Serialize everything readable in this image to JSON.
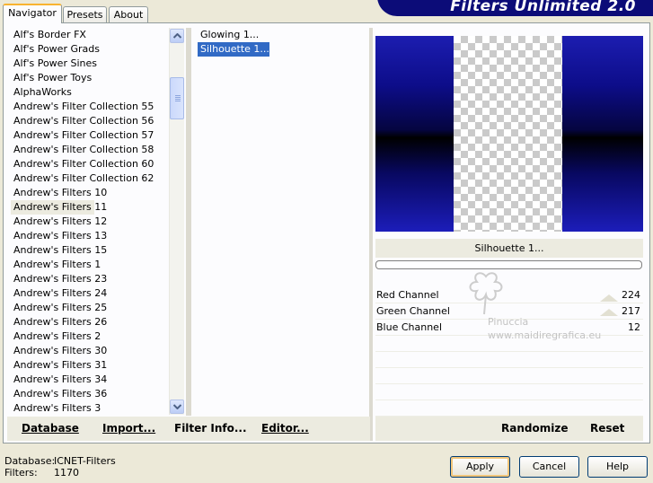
{
  "banner": {
    "title": "Filters Unlimited 2.0"
  },
  "tabs": [
    {
      "label": "Navigator",
      "active": true
    },
    {
      "label": "Presets",
      "active": false
    },
    {
      "label": "About",
      "active": false
    }
  ],
  "categories": {
    "selected": "Andrew's Filters 11",
    "items": [
      "Alf's Border FX",
      "Alf's Power Grads",
      "Alf's Power Sines",
      "Alf's Power Toys",
      "AlphaWorks",
      "Andrew's Filter Collection 55",
      "Andrew's Filter Collection 56",
      "Andrew's Filter Collection 57",
      "Andrew's Filter Collection 58",
      "Andrew's Filter Collection 60",
      "Andrew's Filter Collection 62",
      "Andrew's Filters 10",
      "Andrew's Filters 11",
      "Andrew's Filters 12",
      "Andrew's Filters 13",
      "Andrew's Filters 15",
      "Andrew's Filters 1",
      "Andrew's Filters 23",
      "Andrew's Filters 24",
      "Andrew's Filters 25",
      "Andrew's Filters 26",
      "Andrew's Filters 2",
      "Andrew's Filters 30",
      "Andrew's Filters 31",
      "Andrew's Filters 34",
      "Andrew's Filters 36",
      "Andrew's Filters 3"
    ]
  },
  "filters": {
    "selected": "Silhouette 1...",
    "items": [
      "Glowing 1...",
      "Silhouette 1..."
    ]
  },
  "preview": {
    "filter_name": "Silhouette 1...",
    "colors": {
      "blue": "#1c1db0",
      "black": "#000000",
      "checker": "#cacaca"
    }
  },
  "parameters": [
    {
      "label": "Red Channel",
      "value": "224"
    },
    {
      "label": "Green Channel",
      "value": "217"
    },
    {
      "label": "Blue Channel",
      "value": "12"
    }
  ],
  "watermark": {
    "line1": "Pinuccia",
    "line2": "www.maidiregrafica.eu"
  },
  "toolbar_left": {
    "database": "Database",
    "import": "Import...",
    "filter_info": "Filter Info...",
    "editor": "Editor..."
  },
  "toolbar_right": {
    "randomize": "Randomize",
    "reset": "Reset"
  },
  "status": {
    "database_label": "Database:",
    "database_value": "ICNET-Filters",
    "filters_label": "Filters:",
    "filters_value": "1170"
  },
  "buttons": {
    "apply": "Apply",
    "cancel": "Cancel",
    "help": "Help"
  }
}
